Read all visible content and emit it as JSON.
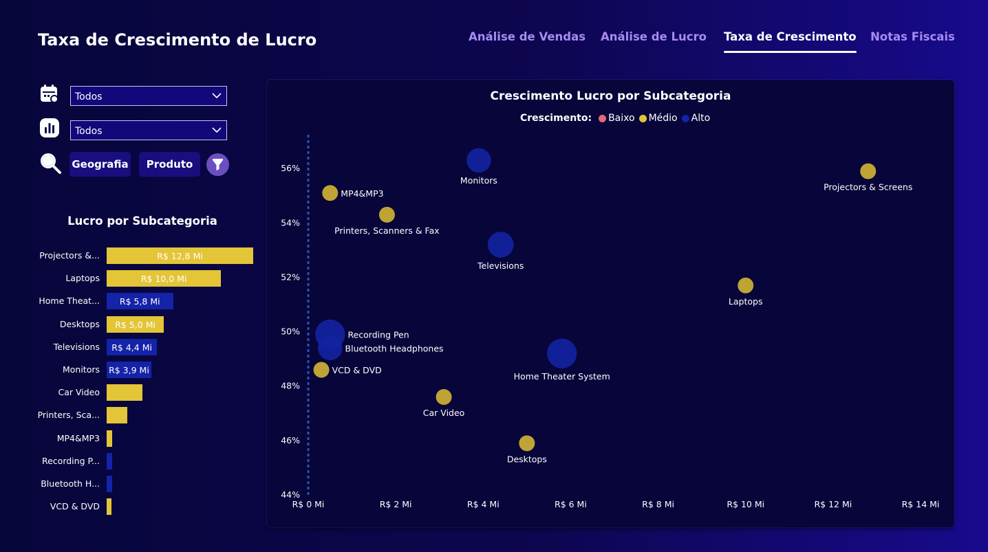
{
  "page_title": "Taxa de Crescimento de Lucro",
  "nav": {
    "tabs": [
      {
        "label": "Análise de Vendas",
        "active": false
      },
      {
        "label": "Análise de Lucro",
        "active": false
      },
      {
        "label": "Taxa de Crescimento",
        "active": true
      },
      {
        "label": "Notas Fiscais",
        "active": false
      }
    ]
  },
  "filters": {
    "date_dropdown": "Todos",
    "category_dropdown": "Todos",
    "buttons": [
      "Geografia",
      "Produto"
    ]
  },
  "colors": {
    "baixo": "#e06a77",
    "medio": "#e3c537",
    "alto": "#1423a8",
    "bar_yellow": "#e3c537",
    "bar_blue": "#1423a8"
  },
  "icons": [
    "calendar-icon",
    "bar-chart-icon",
    "search-icon",
    "chevron-down-icon",
    "filter-icon"
  ],
  "chart_data": [
    {
      "type": "bar",
      "orientation": "horizontal",
      "title": "Lucro por Subcategoria",
      "categories": [
        "Projectors &...",
        "Laptops",
        "Home Theat...",
        "Desktops",
        "Televisions",
        "Monitors",
        "Car Video",
        "Printers, Sca...",
        "MP4&MP3",
        "Recording P...",
        "Bluetooth H...",
        "VCD & DVD"
      ],
      "values": [
        12.8,
        10.0,
        5.8,
        5.0,
        4.4,
        3.9,
        3.1,
        1.8,
        0.5,
        0.5,
        0.5,
        0.4
      ],
      "data_labels": [
        "R$ 12,8 Mi",
        "R$ 10,0 Mi",
        "R$ 5,8 Mi",
        "R$ 5,0 Mi",
        "R$ 4,4 Mi",
        "R$ 3,9 Mi",
        "",
        "",
        "",
        "",
        "",
        ""
      ],
      "growth": [
        "Médio",
        "Médio",
        "Alto",
        "Médio",
        "Alto",
        "Alto",
        "Médio",
        "Médio",
        "Médio",
        "Alto",
        "Alto",
        "Médio"
      ],
      "unit": "R$ Mi",
      "xlim": [
        0,
        12.8
      ]
    },
    {
      "type": "scatter",
      "title": "Crescimento Lucro por Subcategoria",
      "legend": {
        "title": "Crescimento:",
        "items": [
          "Baixo",
          "Médio",
          "Alto"
        ],
        "position": "top-center"
      },
      "x_ticks": [
        "R$ 0 Mi",
        "R$ 2 Mi",
        "R$ 4 Mi",
        "R$ 6 Mi",
        "R$ 8 Mi",
        "R$ 10 Mi",
        "R$ 12 Mi",
        "R$ 14 Mi"
      ],
      "y_ticks": [
        "56%",
        "54%",
        "52%",
        "50%",
        "48%",
        "46%",
        "44%"
      ],
      "xlim": [
        0,
        14
      ],
      "ylim": [
        44,
        58
      ],
      "reference_line_x": 0,
      "grid": false,
      "points": [
        {
          "label": "Monitors",
          "x": 3.9,
          "y": 56.3,
          "group": "Alto",
          "size": 3.9,
          "label_pos": "below"
        },
        {
          "label": "Projectors & Screens",
          "x": 12.8,
          "y": 55.9,
          "group": "Médio",
          "size": 1.0,
          "label_pos": "below"
        },
        {
          "label": "MP4&MP3",
          "x": 0.5,
          "y": 55.1,
          "group": "Médio",
          "size": 1.0,
          "label_pos": "right"
        },
        {
          "label": "Printers, Scanners & Fax",
          "x": 1.8,
          "y": 54.3,
          "group": "Médio",
          "size": 1.0,
          "label_pos": "below"
        },
        {
          "label": "Televisions",
          "x": 4.4,
          "y": 53.2,
          "group": "Alto",
          "size": 4.4,
          "label_pos": "below"
        },
        {
          "label": "Laptops",
          "x": 10.0,
          "y": 51.7,
          "group": "Médio",
          "size": 1.0,
          "label_pos": "below"
        },
        {
          "label": "Recording Pen",
          "x": 0.5,
          "y": 49.9,
          "group": "Alto",
          "size": 5.8,
          "label_pos": "right"
        },
        {
          "label": "Bluetooth Headphones",
          "x": 0.5,
          "y": 49.4,
          "group": "Alto",
          "size": 3.9,
          "label_pos": "right"
        },
        {
          "label": "Home Theater System",
          "x": 5.8,
          "y": 49.2,
          "group": "Alto",
          "size": 5.8,
          "label_pos": "below"
        },
        {
          "label": "VCD & DVD",
          "x": 0.3,
          "y": 48.6,
          "group": "Médio",
          "size": 1.0,
          "label_pos": "right"
        },
        {
          "label": "Car Video",
          "x": 3.1,
          "y": 47.6,
          "group": "Médio",
          "size": 1.0,
          "label_pos": "below"
        },
        {
          "label": "Desktops",
          "x": 5.0,
          "y": 45.9,
          "group": "Médio",
          "size": 1.0,
          "label_pos": "below"
        }
      ]
    }
  ]
}
